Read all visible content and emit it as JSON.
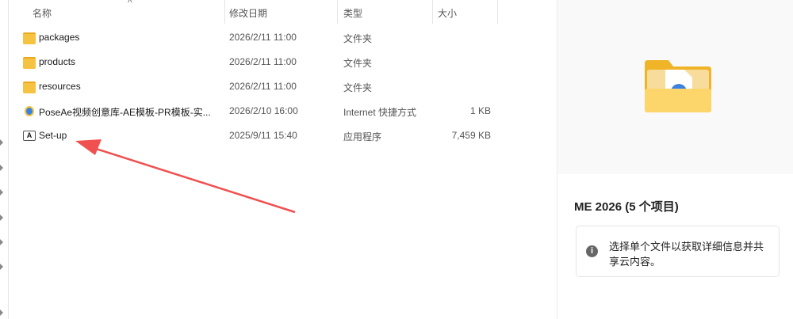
{
  "columns": {
    "name": "名称",
    "date": "修改日期",
    "type": "类型",
    "size": "大小"
  },
  "files": [
    {
      "name": "packages",
      "date": "2026/2/11 11:00",
      "type": "文件夹",
      "size": "",
      "icon": "folder-icon"
    },
    {
      "name": "products",
      "date": "2026/2/11 11:00",
      "type": "文件夹",
      "size": "",
      "icon": "folder-icon"
    },
    {
      "name": "resources",
      "date": "2026/2/11 11:00",
      "type": "文件夹",
      "size": "",
      "icon": "folder-icon"
    },
    {
      "name": "PoseAe视频创意库-AE模板-PR模板-实...",
      "date": "2026/2/10 16:00",
      "type": "Internet 快捷方式",
      "size": "1 KB",
      "icon": "internet-shortcut-icon"
    },
    {
      "name": "Set-up",
      "date": "2025/9/11 15:40",
      "type": "应用程序",
      "size": "7,459 KB",
      "icon": "adobe-setup-icon"
    }
  ],
  "details": {
    "title": "ME 2026 (5 个项目)",
    "info": "选择单个文件以获取详细信息并共享云内容。"
  },
  "annotation_color": "#f05050"
}
